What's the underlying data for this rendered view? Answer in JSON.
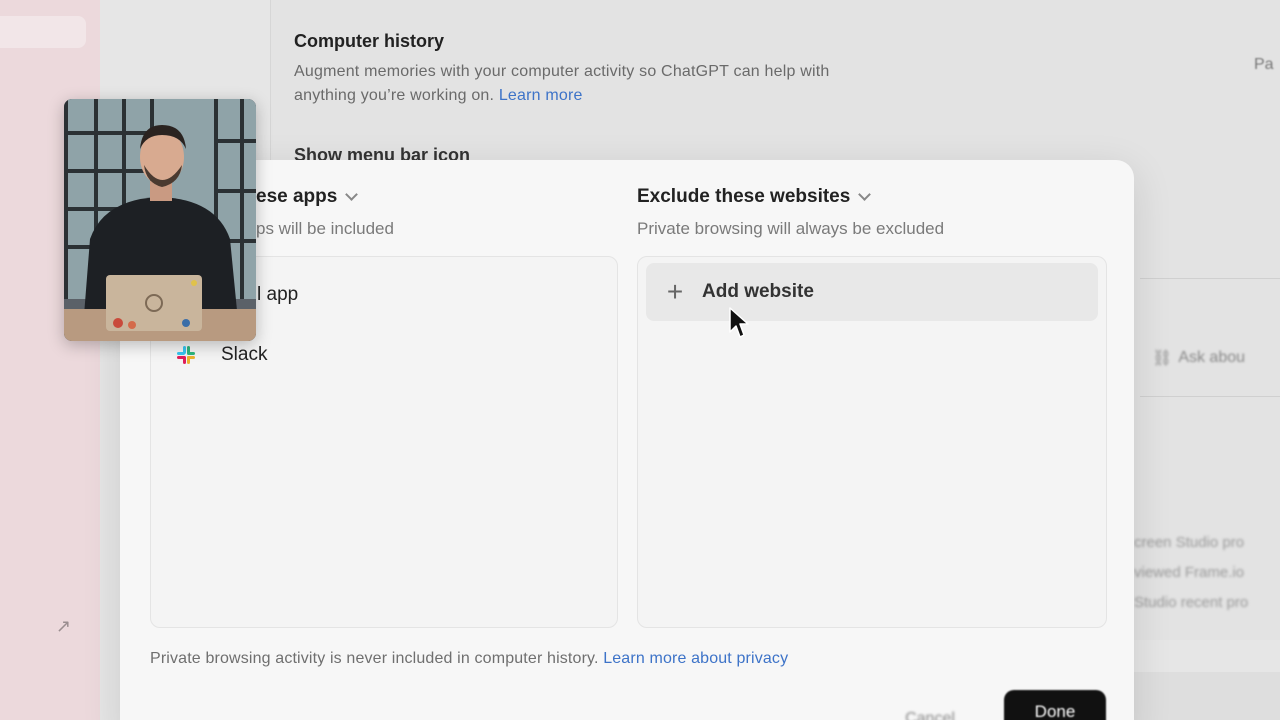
{
  "background": {
    "settings_title": "Computer history",
    "settings_desc_text": "Augment memories with your computer activity so ChatGPT can help with anything you’re working on. ",
    "settings_desc_link": "Learn more",
    "menu_bar_label": "Show menu bar icon",
    "right_chip": "Pa",
    "ask_label": "Ask abou",
    "recent_items": [
      "creen Studio pro",
      "viewed Frame.io",
      "Studio recent pro"
    ]
  },
  "dialog": {
    "include_apps": {
      "header": "ese apps",
      "subtitle": "ps will be included",
      "items": [
        {
          "label": "l app"
        },
        {
          "label": "Slack",
          "icon": "slack-icon"
        }
      ]
    },
    "exclude_websites": {
      "header": "Exclude these websites",
      "subtitle": "Private browsing will always be excluded",
      "add_label": "Add website"
    },
    "footer_text": "Private browsing activity is never included in computer history. ",
    "footer_link": "Learn more about privacy",
    "cancel_label": "Cancel",
    "done_label": "Done"
  },
  "colors": {
    "accent_link": "#3d73c8",
    "primary_button": "#111111",
    "sidebar_bg": "#ecd9dc"
  }
}
